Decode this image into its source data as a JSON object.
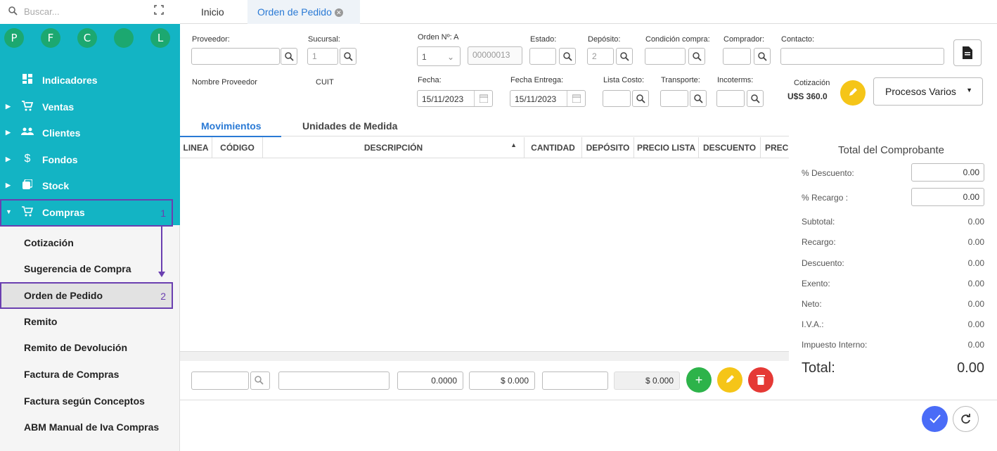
{
  "sidebar": {
    "search_placeholder": "Buscar...",
    "shortcuts": [
      "P",
      "F",
      "C",
      "",
      "L"
    ],
    "menu": [
      {
        "label": "Indicadores",
        "icon": "dashboard-icon"
      },
      {
        "label": "Ventas",
        "icon": "cart-icon"
      },
      {
        "label": "Clientes",
        "icon": "people-icon"
      },
      {
        "label": "Fondos",
        "icon": "dollar-icon"
      },
      {
        "label": "Stock",
        "icon": "box-icon"
      },
      {
        "label": "Compras",
        "icon": "shopping-cart-icon"
      }
    ],
    "compras_annotation": "1",
    "submenu": [
      "Cotización",
      "Sugerencia de Compra",
      "Orden de Pedido",
      "Remito",
      "Remito de Devolución",
      "Factura de Compras",
      "Factura según Conceptos",
      "ABM Manual de Iva Compras"
    ],
    "selected_annotation": "2"
  },
  "tabs": {
    "home": "Inicio",
    "active": "Orden de Pedido"
  },
  "form": {
    "proveedor": "Proveedor:",
    "sucursal": "Sucursal:",
    "sucursal_value": "1",
    "orden": "Orden Nº: A",
    "orden_serie": "1",
    "orden_numero": "00000013",
    "estado": "Estado:",
    "deposito": "Depósito:",
    "deposito_value": "2",
    "condicion": "Condición compra:",
    "comprador": "Comprador:",
    "contacto": "Contacto:",
    "nombre_proveedor": "Nombre Proveedor",
    "cuit": "CUIT",
    "fecha": "Fecha:",
    "fecha_value": "15/11/2023",
    "fecha_entrega": "Fecha Entrega:",
    "fecha_entrega_value": "15/11/2023",
    "lista_costo": "Lista Costo:",
    "transporte": "Transporte:",
    "incoterms": "Incoterms:",
    "cotizacion": "Cotización",
    "cotizacion_value": "U$S  360.0",
    "procesos": "Procesos Varios"
  },
  "subtabs": {
    "movimientos": "Movimientos",
    "unidades": "Unidades de Medida"
  },
  "grid": {
    "columns": [
      "LINEA",
      "CÓDIGO",
      "DESCRIPCIÓN",
      "CANTIDAD",
      "DEPÓSITO",
      "PRECIO LISTA",
      "DESCUENTO",
      "PRECI"
    ]
  },
  "footer": {
    "cantidad": "0.0000",
    "precio": "$ 0.000",
    "total": "$ 0.000"
  },
  "totals": {
    "title": "Total del Comprobante",
    "descuento_label": "% Descuento:",
    "descuento_value": "0.00",
    "recargo_label": "% Recargo :",
    "recargo_value": "0.00",
    "rows": [
      {
        "label": "Subtotal:",
        "value": "0.00"
      },
      {
        "label": "Recargo:",
        "value": "0.00"
      },
      {
        "label": "Descuento:",
        "value": "0.00"
      },
      {
        "label": "Exento:",
        "value": "0.00"
      },
      {
        "label": "Neto:",
        "value": "0.00"
      },
      {
        "label": "I.V.A.:",
        "value": "0.00"
      },
      {
        "label": "Impuesto Interno:",
        "value": "0.00"
      }
    ],
    "total_label": "Total:",
    "total_value": "0.00"
  },
  "colors": {
    "teal": "#13b4c4",
    "green": "#1ca870",
    "blue": "#2a7ad5",
    "purple": "#6a3fb0",
    "yellow": "#f5c518",
    "red": "#e53935",
    "add_green": "#2db34a",
    "confirm_blue": "#4a6cf7"
  }
}
